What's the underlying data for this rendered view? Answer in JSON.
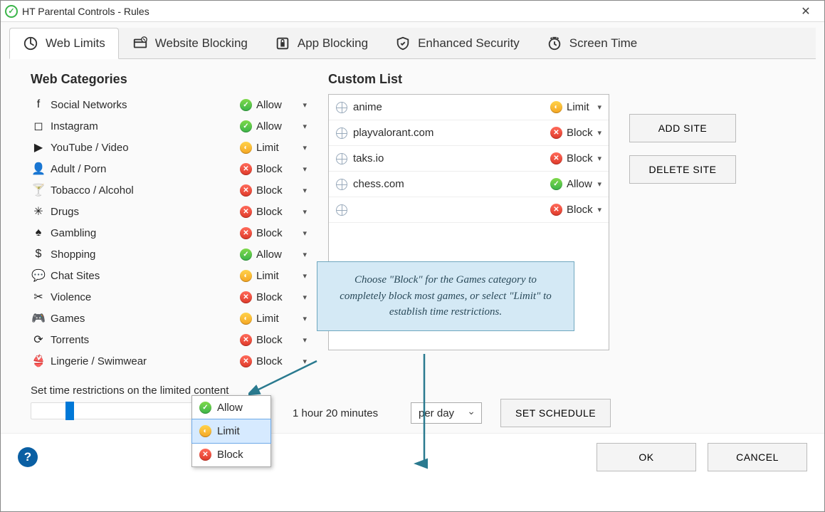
{
  "window": {
    "title": "HT Parental Controls - Rules"
  },
  "tabs": [
    {
      "label": "Web Limits",
      "icon": "web-limits-icon",
      "active": true
    },
    {
      "label": "Website Blocking",
      "icon": "website-blocking-icon",
      "active": false
    },
    {
      "label": "App Blocking",
      "icon": "app-blocking-icon",
      "active": false
    },
    {
      "label": "Enhanced Security",
      "icon": "shield-icon",
      "active": false
    },
    {
      "label": "Screen Time",
      "icon": "clock-icon",
      "active": false
    }
  ],
  "headings": {
    "categories": "Web Categories",
    "custom_list": "Custom List"
  },
  "actions": {
    "allow": "Allow",
    "limit": "Limit",
    "block": "Block"
  },
  "categories": [
    {
      "icon": "facebook-icon",
      "glyph": "f",
      "label": "Social Networks",
      "action": "allow"
    },
    {
      "icon": "instagram-icon",
      "glyph": "◻",
      "label": "Instagram",
      "action": "allow"
    },
    {
      "icon": "youtube-icon",
      "glyph": "▶",
      "label": "YouTube / Video",
      "action": "limit"
    },
    {
      "icon": "adult-icon",
      "glyph": "👤",
      "label": "Adult / Porn",
      "action": "block"
    },
    {
      "icon": "alcohol-icon",
      "glyph": "🍸",
      "label": "Tobacco / Alcohol",
      "action": "block"
    },
    {
      "icon": "drugs-icon",
      "glyph": "✳",
      "label": "Drugs",
      "action": "block"
    },
    {
      "icon": "gambling-icon",
      "glyph": "♠",
      "label": "Gambling",
      "action": "block"
    },
    {
      "icon": "shopping-icon",
      "glyph": "$",
      "label": "Shopping",
      "action": "allow"
    },
    {
      "icon": "chat-icon",
      "glyph": "💬",
      "label": "Chat Sites",
      "action": "limit"
    },
    {
      "icon": "violence-icon",
      "glyph": "✂",
      "label": "Violence",
      "action": "block"
    },
    {
      "icon": "games-icon",
      "glyph": "🎮",
      "label": "Games",
      "action": "limit"
    },
    {
      "icon": "torrents-icon",
      "glyph": "⟳",
      "label": "Torrents",
      "action": "block"
    },
    {
      "icon": "lingerie-icon",
      "glyph": "👙",
      "label": "Lingerie / Swimwear",
      "action": "block"
    }
  ],
  "custom_list": [
    {
      "site": "anime",
      "action": "limit"
    },
    {
      "site": "playvalorant.com",
      "action": "block"
    },
    {
      "site": "taks.io",
      "action": "block"
    },
    {
      "site": "chess.com",
      "action": "allow"
    },
    {
      "site": "",
      "action": "block"
    }
  ],
  "buttons": {
    "add_site": "ADD SITE",
    "delete_site": "DELETE SITE",
    "set_schedule": "SET SCHEDULE",
    "ok": "OK",
    "cancel": "CANCEL"
  },
  "limit": {
    "caption": "Set time restrictions on the limited content",
    "value_text": "1 hour 20 minutes",
    "period": "per day",
    "slider_position_pct": 14
  },
  "dropdown": {
    "options": [
      "Allow",
      "Limit",
      "Block"
    ],
    "selected": "Limit"
  },
  "callout": {
    "text": "Choose \"Block\" for the Games category to completely block most games, or select \"Limit\" to establish time restrictions."
  },
  "colors": {
    "allow": "#3bb54a",
    "limit": "#f5a623",
    "block": "#e03a2a",
    "callout_bg": "#d4e9f5",
    "callout_border": "#6fa7bf",
    "accent": "#0078d7"
  }
}
